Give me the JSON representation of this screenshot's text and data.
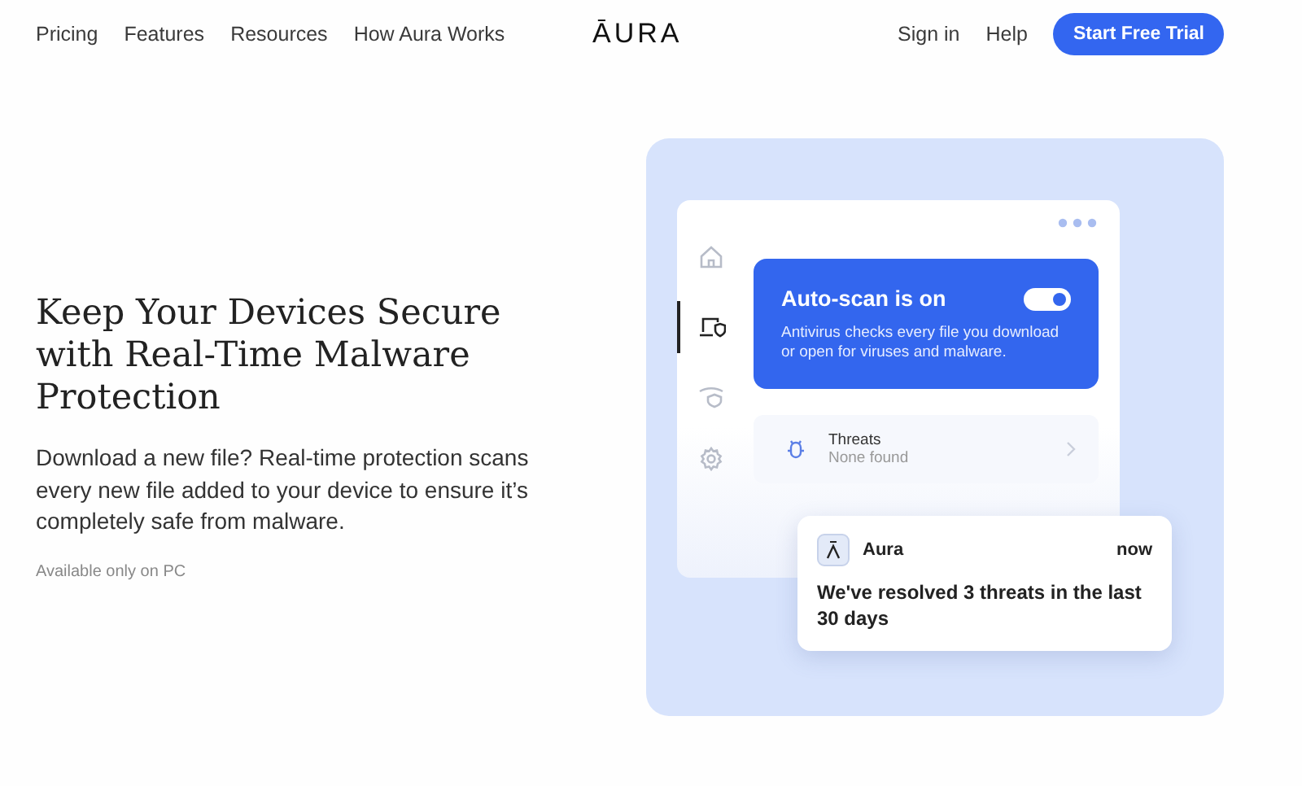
{
  "nav": {
    "links": [
      {
        "label": "Pricing"
      },
      {
        "label": "Features"
      },
      {
        "label": "Resources"
      },
      {
        "label": "How Aura Works"
      }
    ],
    "logo": "ĀURA",
    "actions": [
      {
        "label": "Sign in"
      },
      {
        "label": "Help"
      }
    ],
    "cta": "Start Free Trial"
  },
  "hero": {
    "title": "Keep Your Devices Secure with Real-Time Malware Protection",
    "body": "Download a new file? Real-time protection scans every new file added to your device to ensure it’s completely safe from malware.",
    "note": "Available only on PC"
  },
  "app": {
    "sidebar": [
      {
        "kind": "home",
        "selected": false
      },
      {
        "kind": "device",
        "selected": true
      },
      {
        "kind": "shield",
        "selected": false
      },
      {
        "kind": "gear",
        "selected": false
      }
    ],
    "scan_card": {
      "title": "Auto-scan is on",
      "on": true,
      "text": "Antivirus checks every file you download or open for viruses and malware."
    },
    "threats": {
      "title": "Threats",
      "status": "None found"
    }
  },
  "notification": {
    "app": "Aura",
    "time": "now",
    "message": "We've resolved 3 threats in the last 30 days"
  }
}
